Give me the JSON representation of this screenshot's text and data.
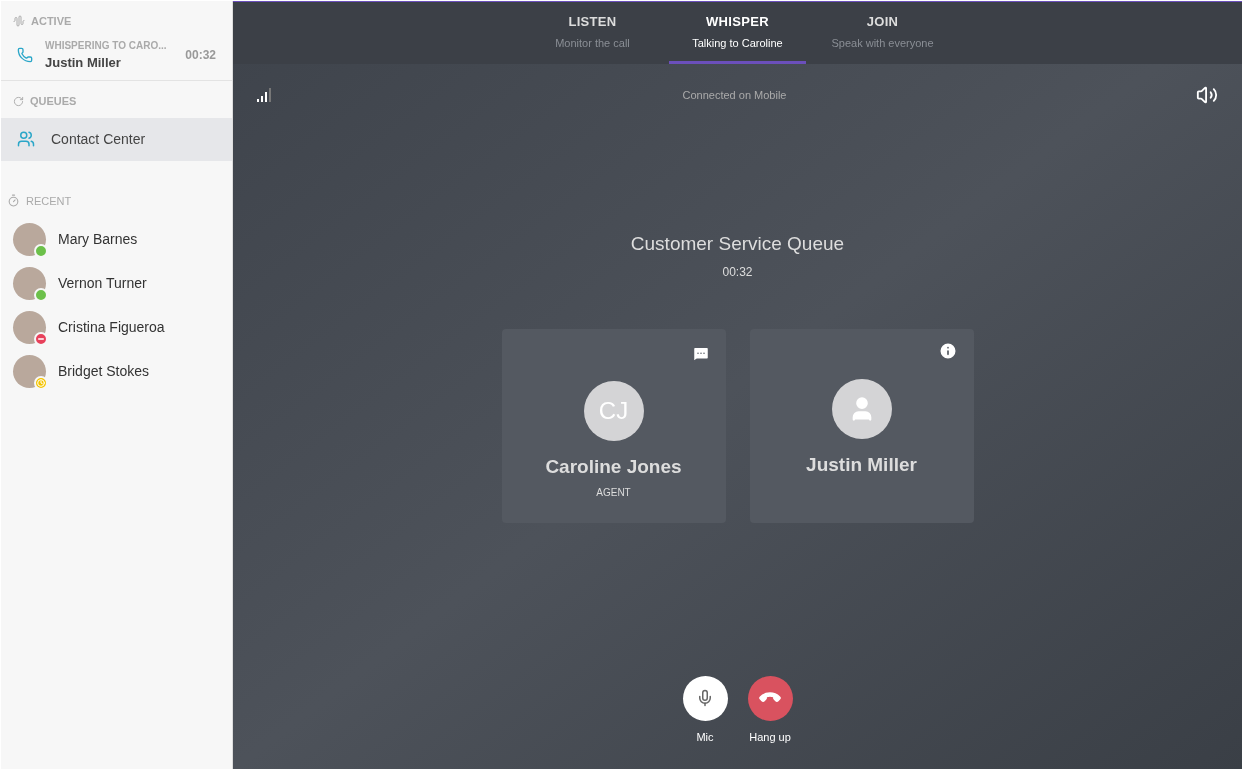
{
  "sidebar": {
    "active": {
      "heading": "ACTIVE",
      "call": {
        "status": "WHISPERING TO CARO...",
        "name": "Justin Miller",
        "duration": "00:32"
      }
    },
    "queues": {
      "heading": "QUEUES",
      "items": [
        {
          "label": "Contact Center",
          "selected": true
        }
      ]
    },
    "recent": {
      "heading": "RECENT",
      "contacts": [
        {
          "name": "Mary Barnes",
          "color": "#6cc04a",
          "kind": "online"
        },
        {
          "name": "Vernon Turner",
          "color": "#6cc04a",
          "kind": "online"
        },
        {
          "name": "Cristina Figueroa",
          "color": "#e8415b",
          "kind": "busy"
        },
        {
          "name": "Bridget Stokes",
          "color": "#f5c400",
          "kind": "away"
        }
      ]
    }
  },
  "tabs": [
    {
      "label": "LISTEN",
      "subtitle": "Monitor the call",
      "selected": false
    },
    {
      "label": "WHISPER",
      "subtitle": "Talking to Caroline",
      "selected": true
    },
    {
      "label": "JOIN",
      "subtitle": "Speak with everyone",
      "selected": false
    }
  ],
  "connection": "Connected on Mobile",
  "call": {
    "title": "Customer Service Queue",
    "duration": "00:32"
  },
  "participants": [
    {
      "kind": "initials",
      "initials": "CJ",
      "name": "Caroline Jones",
      "role": "AGENT"
    },
    {
      "kind": "generic",
      "name": "Justin Miller"
    }
  ],
  "controls": [
    {
      "kind": "mic",
      "label": "Mic"
    },
    {
      "kind": "hangup",
      "label": "Hang up"
    }
  ]
}
